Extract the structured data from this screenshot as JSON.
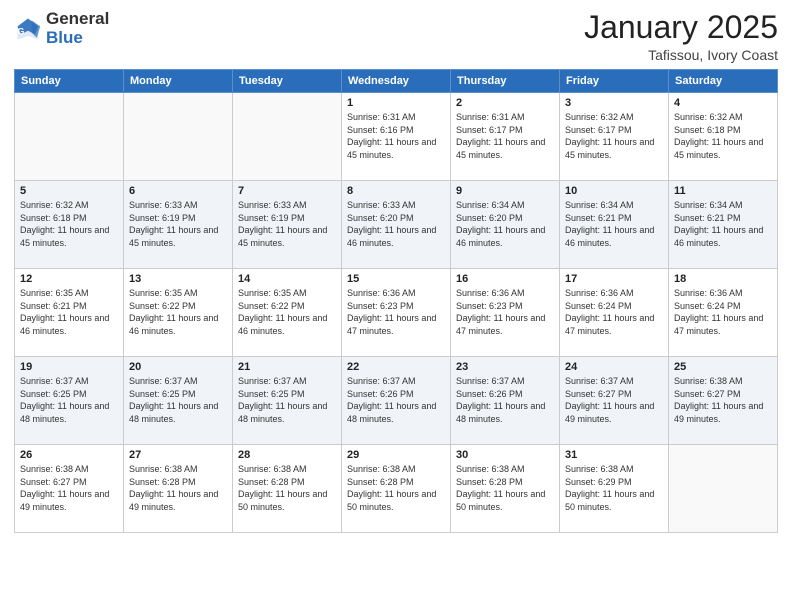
{
  "header": {
    "logo_general": "General",
    "logo_blue": "Blue",
    "month_title": "January 2025",
    "subtitle": "Tafissou, Ivory Coast"
  },
  "weekdays": [
    "Sunday",
    "Monday",
    "Tuesday",
    "Wednesday",
    "Thursday",
    "Friday",
    "Saturday"
  ],
  "weeks": [
    [
      {
        "day": "",
        "sunrise": "",
        "sunset": "",
        "daylight": ""
      },
      {
        "day": "",
        "sunrise": "",
        "sunset": "",
        "daylight": ""
      },
      {
        "day": "",
        "sunrise": "",
        "sunset": "",
        "daylight": ""
      },
      {
        "day": "1",
        "sunrise": "Sunrise: 6:31 AM",
        "sunset": "Sunset: 6:16 PM",
        "daylight": "Daylight: 11 hours and 45 minutes."
      },
      {
        "day": "2",
        "sunrise": "Sunrise: 6:31 AM",
        "sunset": "Sunset: 6:17 PM",
        "daylight": "Daylight: 11 hours and 45 minutes."
      },
      {
        "day": "3",
        "sunrise": "Sunrise: 6:32 AM",
        "sunset": "Sunset: 6:17 PM",
        "daylight": "Daylight: 11 hours and 45 minutes."
      },
      {
        "day": "4",
        "sunrise": "Sunrise: 6:32 AM",
        "sunset": "Sunset: 6:18 PM",
        "daylight": "Daylight: 11 hours and 45 minutes."
      }
    ],
    [
      {
        "day": "5",
        "sunrise": "Sunrise: 6:32 AM",
        "sunset": "Sunset: 6:18 PM",
        "daylight": "Daylight: 11 hours and 45 minutes."
      },
      {
        "day": "6",
        "sunrise": "Sunrise: 6:33 AM",
        "sunset": "Sunset: 6:19 PM",
        "daylight": "Daylight: 11 hours and 45 minutes."
      },
      {
        "day": "7",
        "sunrise": "Sunrise: 6:33 AM",
        "sunset": "Sunset: 6:19 PM",
        "daylight": "Daylight: 11 hours and 45 minutes."
      },
      {
        "day": "8",
        "sunrise": "Sunrise: 6:33 AM",
        "sunset": "Sunset: 6:20 PM",
        "daylight": "Daylight: 11 hours and 46 minutes."
      },
      {
        "day": "9",
        "sunrise": "Sunrise: 6:34 AM",
        "sunset": "Sunset: 6:20 PM",
        "daylight": "Daylight: 11 hours and 46 minutes."
      },
      {
        "day": "10",
        "sunrise": "Sunrise: 6:34 AM",
        "sunset": "Sunset: 6:21 PM",
        "daylight": "Daylight: 11 hours and 46 minutes."
      },
      {
        "day": "11",
        "sunrise": "Sunrise: 6:34 AM",
        "sunset": "Sunset: 6:21 PM",
        "daylight": "Daylight: 11 hours and 46 minutes."
      }
    ],
    [
      {
        "day": "12",
        "sunrise": "Sunrise: 6:35 AM",
        "sunset": "Sunset: 6:21 PM",
        "daylight": "Daylight: 11 hours and 46 minutes."
      },
      {
        "day": "13",
        "sunrise": "Sunrise: 6:35 AM",
        "sunset": "Sunset: 6:22 PM",
        "daylight": "Daylight: 11 hours and 46 minutes."
      },
      {
        "day": "14",
        "sunrise": "Sunrise: 6:35 AM",
        "sunset": "Sunset: 6:22 PM",
        "daylight": "Daylight: 11 hours and 46 minutes."
      },
      {
        "day": "15",
        "sunrise": "Sunrise: 6:36 AM",
        "sunset": "Sunset: 6:23 PM",
        "daylight": "Daylight: 11 hours and 47 minutes."
      },
      {
        "day": "16",
        "sunrise": "Sunrise: 6:36 AM",
        "sunset": "Sunset: 6:23 PM",
        "daylight": "Daylight: 11 hours and 47 minutes."
      },
      {
        "day": "17",
        "sunrise": "Sunrise: 6:36 AM",
        "sunset": "Sunset: 6:24 PM",
        "daylight": "Daylight: 11 hours and 47 minutes."
      },
      {
        "day": "18",
        "sunrise": "Sunrise: 6:36 AM",
        "sunset": "Sunset: 6:24 PM",
        "daylight": "Daylight: 11 hours and 47 minutes."
      }
    ],
    [
      {
        "day": "19",
        "sunrise": "Sunrise: 6:37 AM",
        "sunset": "Sunset: 6:25 PM",
        "daylight": "Daylight: 11 hours and 48 minutes."
      },
      {
        "day": "20",
        "sunrise": "Sunrise: 6:37 AM",
        "sunset": "Sunset: 6:25 PM",
        "daylight": "Daylight: 11 hours and 48 minutes."
      },
      {
        "day": "21",
        "sunrise": "Sunrise: 6:37 AM",
        "sunset": "Sunset: 6:25 PM",
        "daylight": "Daylight: 11 hours and 48 minutes."
      },
      {
        "day": "22",
        "sunrise": "Sunrise: 6:37 AM",
        "sunset": "Sunset: 6:26 PM",
        "daylight": "Daylight: 11 hours and 48 minutes."
      },
      {
        "day": "23",
        "sunrise": "Sunrise: 6:37 AM",
        "sunset": "Sunset: 6:26 PM",
        "daylight": "Daylight: 11 hours and 48 minutes."
      },
      {
        "day": "24",
        "sunrise": "Sunrise: 6:37 AM",
        "sunset": "Sunset: 6:27 PM",
        "daylight": "Daylight: 11 hours and 49 minutes."
      },
      {
        "day": "25",
        "sunrise": "Sunrise: 6:38 AM",
        "sunset": "Sunset: 6:27 PM",
        "daylight": "Daylight: 11 hours and 49 minutes."
      }
    ],
    [
      {
        "day": "26",
        "sunrise": "Sunrise: 6:38 AM",
        "sunset": "Sunset: 6:27 PM",
        "daylight": "Daylight: 11 hours and 49 minutes."
      },
      {
        "day": "27",
        "sunrise": "Sunrise: 6:38 AM",
        "sunset": "Sunset: 6:28 PM",
        "daylight": "Daylight: 11 hours and 49 minutes."
      },
      {
        "day": "28",
        "sunrise": "Sunrise: 6:38 AM",
        "sunset": "Sunset: 6:28 PM",
        "daylight": "Daylight: 11 hours and 50 minutes."
      },
      {
        "day": "29",
        "sunrise": "Sunrise: 6:38 AM",
        "sunset": "Sunset: 6:28 PM",
        "daylight": "Daylight: 11 hours and 50 minutes."
      },
      {
        "day": "30",
        "sunrise": "Sunrise: 6:38 AM",
        "sunset": "Sunset: 6:28 PM",
        "daylight": "Daylight: 11 hours and 50 minutes."
      },
      {
        "day": "31",
        "sunrise": "Sunrise: 6:38 AM",
        "sunset": "Sunset: 6:29 PM",
        "daylight": "Daylight: 11 hours and 50 minutes."
      },
      {
        "day": "",
        "sunrise": "",
        "sunset": "",
        "daylight": ""
      }
    ]
  ]
}
